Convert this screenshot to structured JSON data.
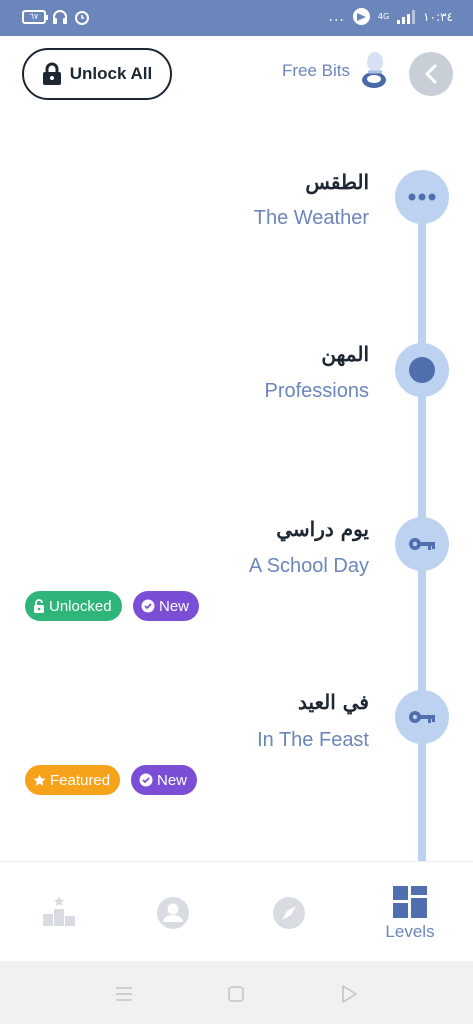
{
  "status_bar": {
    "battery": "٦٧",
    "network": "4G",
    "time": "١٠:٣٤",
    "dots": "..."
  },
  "header": {
    "unlock_all_label": "Unlock All",
    "free_bits_label": "Free Bits"
  },
  "levels": [
    {
      "title_ar": "الطقس",
      "title_en": "The Weather",
      "node_icon": "more-dots-icon",
      "badges": []
    },
    {
      "title_ar": "المهن",
      "title_en": "Professions",
      "node_icon": "current-dot-icon",
      "badges": []
    },
    {
      "title_ar": "يوم دراسي",
      "title_en": "A School Day",
      "node_icon": "key-icon",
      "badges": [
        {
          "label": "Unlocked",
          "icon": "unlock-icon",
          "color": "#2fb47a"
        },
        {
          "label": "New",
          "icon": "verified-icon",
          "color": "#7a4fd6"
        }
      ]
    },
    {
      "title_ar": "في العيد",
      "title_en": "In The Feast",
      "node_icon": "key-icon",
      "badges": [
        {
          "label": "Featured",
          "icon": "star-icon",
          "color": "#f7a21b"
        },
        {
          "label": "New",
          "icon": "verified-icon",
          "color": "#7a4fd6"
        }
      ]
    }
  ],
  "bottom_nav": {
    "items": [
      {
        "icon": "leaderboard-icon",
        "label": ""
      },
      {
        "icon": "profile-icon",
        "label": ""
      },
      {
        "icon": "compass-icon",
        "label": ""
      },
      {
        "icon": "levels-grid-icon",
        "label": "Levels",
        "active": true
      }
    ]
  },
  "colors": {
    "status_bar": "#6b86bb",
    "accent": "#6b86bb",
    "timeline": "#bdd2f0",
    "dark_text": "#1d2734"
  }
}
